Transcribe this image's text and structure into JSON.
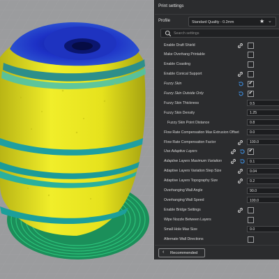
{
  "panel": {
    "title": "Print settings",
    "profile_label": "Profile",
    "profile_value": "Standard Quality - 0.2mm",
    "profile_star_icon": "star-icon",
    "search_placeholder": "Search settings",
    "recommended_label": "Recommended"
  },
  "settings": [
    {
      "label": "Enable Draft Shield",
      "italic": false,
      "indent": false,
      "link": true,
      "reset": false,
      "type": "checkbox",
      "checked": false
    },
    {
      "label": "Make Overhang Printable",
      "italic": false,
      "indent": false,
      "link": false,
      "reset": false,
      "type": "checkbox",
      "checked": false
    },
    {
      "label": "Enable Coasting",
      "italic": false,
      "indent": false,
      "link": false,
      "reset": false,
      "type": "checkbox",
      "checked": false
    },
    {
      "label": "Enable Conical Support",
      "italic": false,
      "indent": false,
      "link": true,
      "reset": false,
      "type": "checkbox",
      "checked": false
    },
    {
      "label": "Fuzzy Skin",
      "italic": true,
      "indent": false,
      "link": false,
      "reset": true,
      "type": "checkbox",
      "checked": true
    },
    {
      "label": "Fuzzy Skin Outside Only",
      "italic": true,
      "indent": false,
      "link": false,
      "reset": true,
      "type": "checkbox",
      "checked": true
    },
    {
      "label": "Fuzzy Skin Thickness",
      "italic": false,
      "indent": false,
      "link": false,
      "reset": false,
      "type": "value",
      "value": "0.5"
    },
    {
      "label": "Fuzzy Skin Density",
      "italic": false,
      "indent": false,
      "link": false,
      "reset": false,
      "type": "value",
      "value": "1.25"
    },
    {
      "label": "Fuzzy Skin Point Distance",
      "italic": false,
      "indent": true,
      "link": false,
      "reset": false,
      "type": "value",
      "value": "0.8"
    },
    {
      "label": "Flow Rate Compensation Max Extrusion Offset",
      "italic": false,
      "indent": false,
      "link": false,
      "reset": false,
      "type": "value",
      "value": "0.0"
    },
    {
      "label": "Flow Rate Compensation Factor",
      "italic": false,
      "indent": false,
      "link": true,
      "reset": false,
      "type": "value",
      "value": "100.0"
    },
    {
      "label": "Use Adaptive Layers",
      "italic": true,
      "indent": false,
      "link": true,
      "reset": true,
      "type": "checkbox",
      "checked": true
    },
    {
      "label": "Adaptive Layers Maximum Variation",
      "italic": true,
      "indent": false,
      "link": true,
      "reset": true,
      "type": "value",
      "value": "0.1"
    },
    {
      "label": "Adaptive Layers Variation Step Size",
      "italic": false,
      "indent": false,
      "link": true,
      "reset": false,
      "type": "value",
      "value": "0.04"
    },
    {
      "label": "Adaptive Layers Topography Size",
      "italic": false,
      "indent": false,
      "link": true,
      "reset": false,
      "type": "value",
      "value": "0.2"
    },
    {
      "label": "Overhanging Wall Angle",
      "italic": false,
      "indent": false,
      "link": false,
      "reset": false,
      "type": "value",
      "value": "90.0"
    },
    {
      "label": "Overhanging Wall Speed",
      "italic": false,
      "indent": false,
      "link": false,
      "reset": false,
      "type": "value",
      "value": "100.0"
    },
    {
      "label": "Enable Bridge Settings",
      "italic": false,
      "indent": false,
      "link": true,
      "reset": false,
      "type": "checkbox",
      "checked": false
    },
    {
      "label": "Wipe Nozzle Between Layers",
      "italic": false,
      "indent": false,
      "link": false,
      "reset": false,
      "type": "checkbox",
      "checked": false
    },
    {
      "label": "Small Hole Max Size",
      "italic": false,
      "indent": false,
      "link": false,
      "reset": false,
      "type": "value",
      "value": "0.0"
    },
    {
      "label": "Alternate Wall Directions",
      "italic": false,
      "indent": false,
      "link": false,
      "reset": false,
      "type": "checkbox",
      "checked": false
    }
  ],
  "colors": {
    "panel_bg": "#2b2c2e",
    "reset_icon": "#3d8ee0",
    "model_yellow": "#e8e41c",
    "model_blue": "#1a2bb0",
    "model_teal": "#22a8a0",
    "brim_green": "#1fae6a",
    "buildplate": "#9c9d9f"
  },
  "icons": {
    "link": "link-icon",
    "reset": "reset-icon",
    "search": "search-icon",
    "back": "chevron-left-icon",
    "dropdown": "chevron-down-icon"
  }
}
